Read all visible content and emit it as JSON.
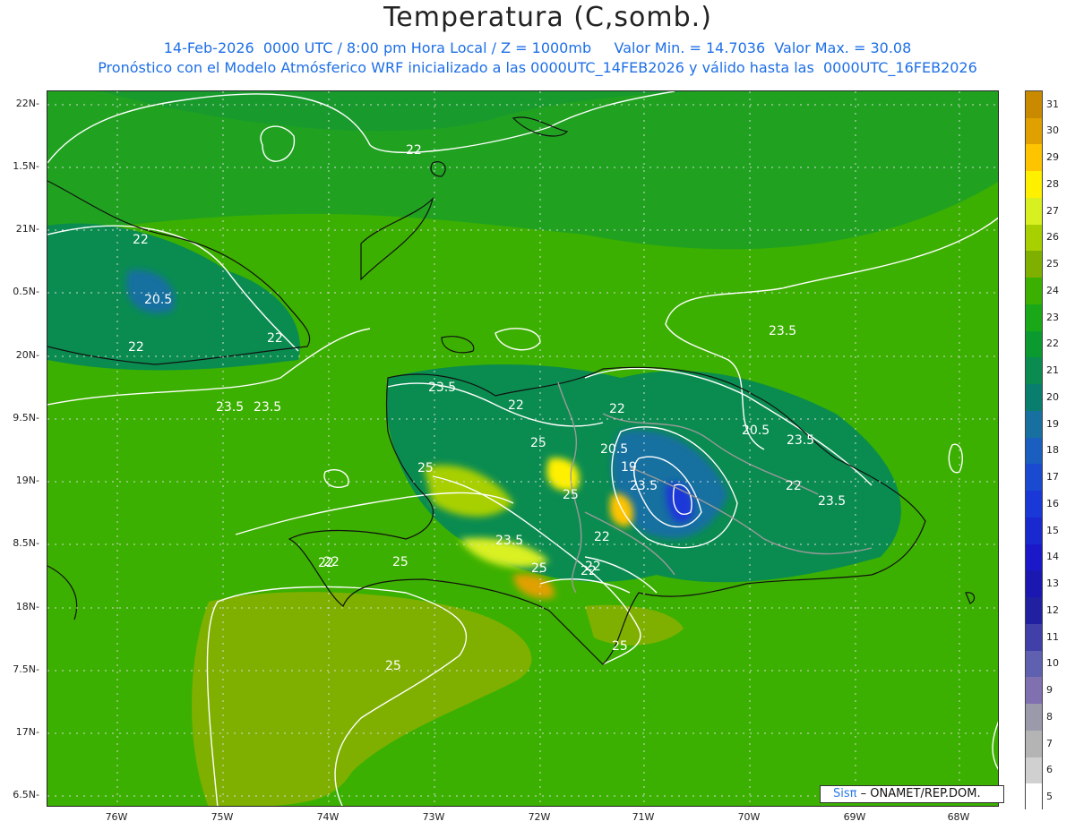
{
  "header": {
    "title": "Temperatura (C,somb.)",
    "subtitle_line1": "14-Feb-2026  0000 UTC / 8:00 pm Hora Local / Z = 1000mb     Valor Min. = 14.7036  Valor Max. = 30.08",
    "subtitle_line2": "Pronóstico con el Modelo Atmósferico WRF inicializado a las 0000UTC_14FEB2026 y válido hasta las  0000UTC_16FEB2026"
  },
  "axes": {
    "lat_labels": [
      "22N",
      "1.5N",
      "21N",
      "0.5N",
      "20N",
      "9.5N",
      "19N",
      "8.5N",
      "18N",
      "7.5N",
      "17N",
      "6.5N"
    ],
    "lon_labels": [
      "76W",
      "75W",
      "74W",
      "73W",
      "72W",
      "71W",
      "70W",
      "69W",
      "68W"
    ]
  },
  "contour_labels": [
    "22",
    "22",
    "22",
    "20.5",
    "22",
    "23.5",
    "23.5",
    "23.5",
    "22",
    "22",
    "20.5",
    "23.5",
    "25",
    "20.5",
    "19",
    "25",
    "23.5",
    "25",
    "22",
    "22",
    "23.5",
    "22",
    "23.5",
    "22",
    "25",
    "25",
    "22",
    "22",
    "25",
    "25",
    "23.5"
  ],
  "colorbar": {
    "labels": [
      "31",
      "30",
      "29",
      "28",
      "27",
      "26",
      "25",
      "24",
      "23",
      "22",
      "21",
      "20",
      "19",
      "18",
      "17",
      "16",
      "15",
      "14",
      "13",
      "12",
      "11",
      "10",
      "9",
      "8",
      "7",
      "6",
      "5"
    ],
    "colors": [
      "#c98a00",
      "#e0a000",
      "#ffc400",
      "#fff000",
      "#d9f020",
      "#a8d000",
      "#7fb000",
      "#3cb000",
      "#18a818",
      "#0a9a30",
      "#0a8c50",
      "#0a7e6e",
      "#1870a0",
      "#1a5ec0",
      "#1a4ad0",
      "#1a38d8",
      "#1a28d0",
      "#1a18c8",
      "#1a18b0",
      "#2020a0",
      "#4040a8",
      "#6060b0",
      "#8070b0",
      "#9a9aaa",
      "#b4b4b4",
      "#d0d0d0",
      "#ffffff"
    ]
  },
  "credit": {
    "brand": "Sisπ",
    "text": "– ONAMET/REP.DOM."
  }
}
